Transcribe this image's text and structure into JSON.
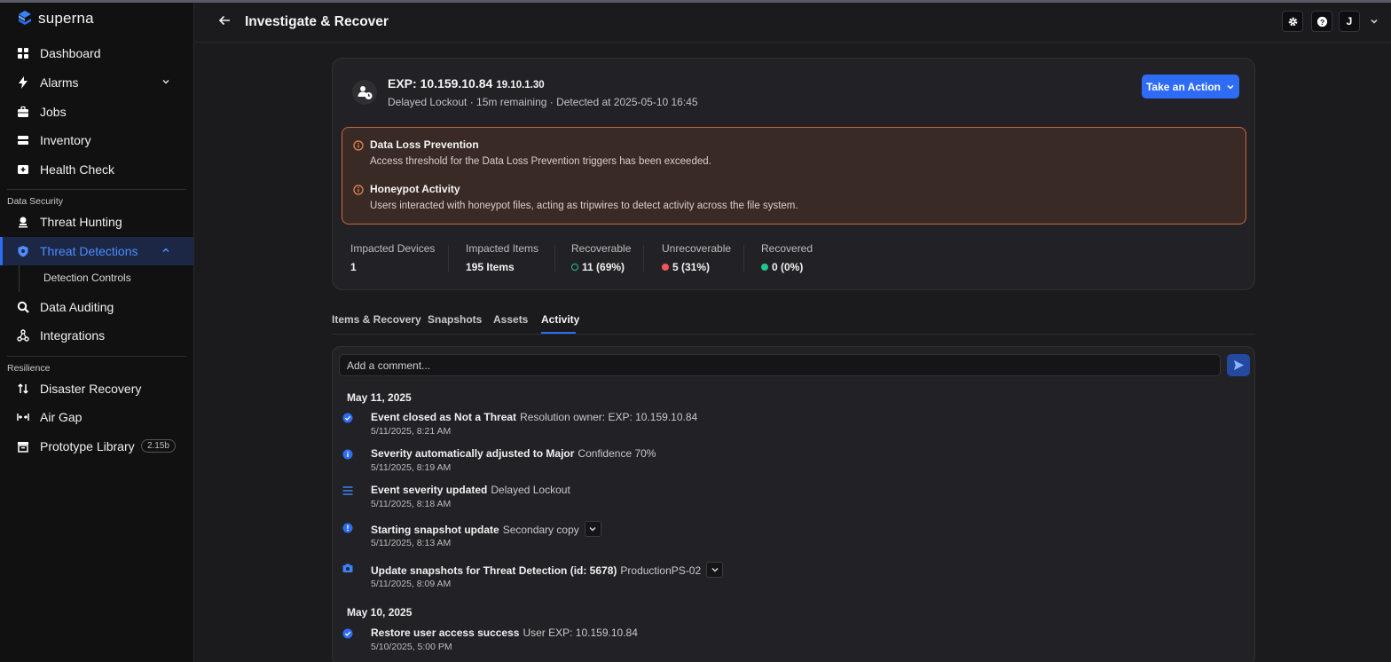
{
  "brand": {
    "name": "superna"
  },
  "sidebar": {
    "items": [
      {
        "label": "Dashboard",
        "icon": "grid-icon"
      },
      {
        "label": "Alarms",
        "icon": "bolt-icon"
      },
      {
        "label": "Jobs",
        "icon": "briefcase-icon"
      },
      {
        "label": "Inventory",
        "icon": "server-icon"
      },
      {
        "label": "Health Check",
        "icon": "medical-icon"
      }
    ],
    "section_data_security": "Data Security",
    "security_items": [
      {
        "label": "Threat Hunting",
        "icon": "threat-hunting-icon"
      },
      {
        "label": "Threat Detections",
        "icon": "shield-icon"
      },
      {
        "label": "Data Auditing",
        "icon": "search-data-icon"
      },
      {
        "label": "Integrations",
        "icon": "integrations-icon"
      }
    ],
    "sub_item": "Detection Controls",
    "section_resilience": "Resilience",
    "resilience_items": [
      {
        "label": "Disaster Recovery",
        "icon": "swap-icon"
      },
      {
        "label": "Air Gap",
        "icon": "air-gap-icon"
      },
      {
        "label": "Prototype Library",
        "icon": "library-icon"
      }
    ],
    "prototype_badge": "2.15b"
  },
  "header": {
    "title": "Investigate & Recover",
    "avatar": "J"
  },
  "event": {
    "title": "EXP: 10.159.10.84",
    "ip": "19.10.1.30",
    "subtitle": "Delayed Lockout · 15m remaining · Detected at 2025-05-10 16:45",
    "action_label": "Take an Action"
  },
  "alerts": [
    {
      "title": "Data Loss Prevention",
      "desc": "Access threshold for the Data Loss Prevention triggers has been exceeded."
    },
    {
      "title": "Honeypot Activity",
      "desc": "Users interacted with honeypot files, acting as tripwires to detect activity across the file system."
    }
  ],
  "stats": [
    {
      "label": "Impacted Devices",
      "value": "1"
    },
    {
      "label": "Impacted Items",
      "value": "195 Items"
    },
    {
      "label": "Recoverable",
      "value": "11 (69%)",
      "color": "#22c58b"
    },
    {
      "label": "Unrecoverable",
      "value": "5 (31%)",
      "color": "#f2545b"
    },
    {
      "label": "Recovered",
      "value": "0 (0%)",
      "color": "#22c58b"
    }
  ],
  "tabs": [
    "Items & Recovery",
    "Snapshots",
    "Assets",
    "Activity"
  ],
  "activity": {
    "comment_placeholder": "Add a comment...",
    "days": [
      "May 11, 2025",
      "May 10, 2025"
    ],
    "entries": [
      {
        "title": "Event closed as Not a Threat",
        "detail": "Resolution owner: EXP: 10.159.10.84",
        "time": "5/11/2025, 8:21 AM",
        "icon": "check-circle-icon"
      },
      {
        "title": "Severity automatically adjusted to Major",
        "detail": "Confidence 70%",
        "time": "5/11/2025, 8:19 AM",
        "icon": "info-icon"
      },
      {
        "title": "Event severity updated",
        "detail": "Delayed Lockout",
        "time": "5/11/2025, 8:18 AM",
        "icon": "list-icon"
      },
      {
        "title": "Starting snapshot update",
        "detail": "Secondary copy",
        "time": "5/11/2025, 8:13 AM",
        "icon": "info-icon"
      },
      {
        "title": "Update snapshots for Threat Detection (id: 5678)",
        "detail": "ProductionPS-02",
        "time": "5/11/2025, 8:09 AM",
        "icon": "camera-icon"
      },
      {
        "title": "Restore user access success",
        "detail": "User EXP: 10.159.10.84",
        "time": "5/10/2025, 5:00 PM",
        "icon": "check-circle-icon"
      }
    ]
  },
  "colors": {
    "accent": "#2f6cf6",
    "warning": "#c6683d",
    "success": "#22c58b",
    "danger": "#f2545b"
  }
}
